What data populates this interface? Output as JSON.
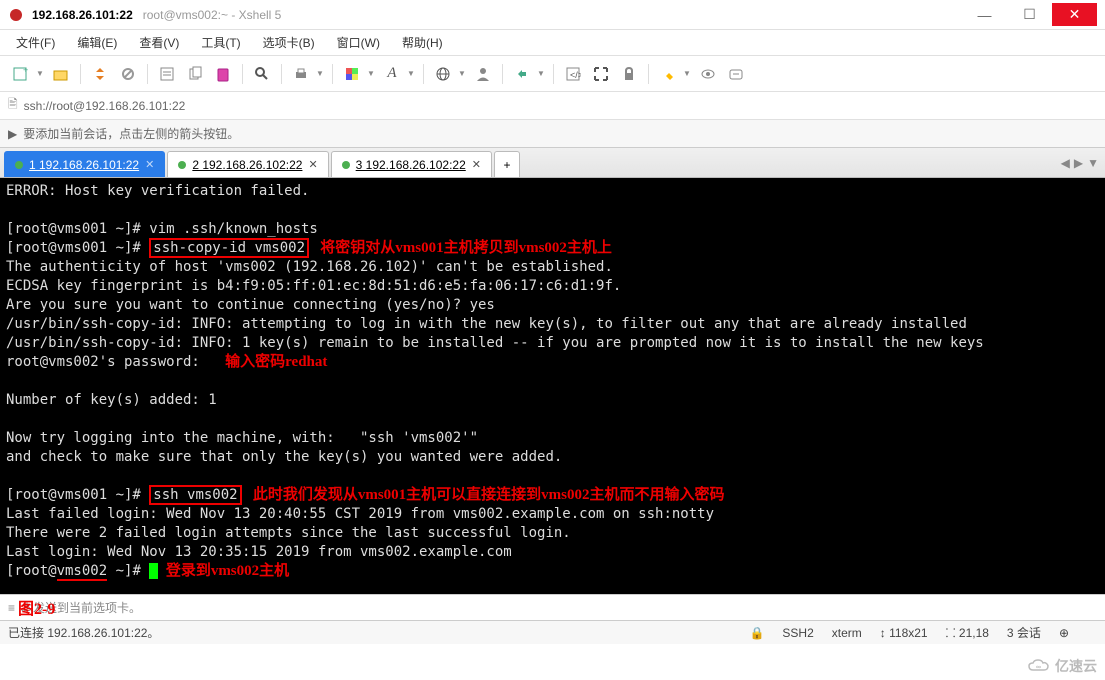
{
  "window": {
    "title_main": "192.168.26.101:22",
    "title_sub": "root@vms002:~ - Xshell 5"
  },
  "menus": [
    "文件(F)",
    "编辑(E)",
    "查看(V)",
    "工具(T)",
    "选项卡(B)",
    "窗口(W)",
    "帮助(H)"
  ],
  "address": "ssh://root@192.168.26.101:22",
  "hint": "要添加当前会话，点击左侧的箭头按钮。",
  "tabs": [
    {
      "label": "1 192.168.26.101:22",
      "active": true
    },
    {
      "label": "2 192.168.26.102:22",
      "active": false
    },
    {
      "label": "3 192.168.26.102:22",
      "active": false
    }
  ],
  "terminal": {
    "l1": "ERROR: Host key verification failed.",
    "l2": "",
    "l3a": "[root@vms001 ~]# vim .ssh/known_hosts",
    "l4a": "[root@vms001 ~]# ",
    "l4_box": "ssh-copy-id vms002",
    "l4_ann": "   将密钥对从vms001主机拷贝到vms002主机上",
    "l5": "The authenticity of host 'vms002 (192.168.26.102)' can't be established.",
    "l6": "ECDSA key fingerprint is b4:f9:05:ff:01:ec:8d:51:d6:e5:fa:06:17:c6:d1:9f.",
    "l7": "Are you sure you want to continue connecting (yes/no)? yes",
    "l8": "/usr/bin/ssh-copy-id: INFO: attempting to log in with the new key(s), to filter out any that are already installed",
    "l9": "/usr/bin/ssh-copy-id: INFO: 1 key(s) remain to be installed -- if you are prompted now it is to install the new keys",
    "l10a": "root@vms002's password:   ",
    "l10_ann": "输入密码redhat",
    "l11": "",
    "l12": "Number of key(s) added: 1",
    "l13": "",
    "l14": "Now try logging into the machine, with:   \"ssh 'vms002'\"",
    "l15": "and check to make sure that only the key(s) you wanted were added.",
    "l16": "",
    "l17a": "[root@vms001 ~]# ",
    "l17_box": "ssh vms002",
    "l17_ann": "   此时我们发现从vms001主机可以直接连接到vms002主机而不用输入密码",
    "l18": "Last failed login: Wed Nov 13 20:40:55 CST 2019 from vms002.example.com on ssh:notty",
    "l19": "There were 2 failed login attempts since the last successful login.",
    "l20": "Last login: Wed Nov 13 20:35:15 2019 from vms002.example.com",
    "l21a": "[root@",
    "l21_under": "vms002",
    "l21b": " ~]# ",
    "l21_ann": "  登录到vms002主机",
    "fig": "图2-9"
  },
  "sendbar_hint": "本发送到当前选项卡。",
  "status": {
    "conn": "已连接 192.168.26.101:22。",
    "ssh": "SSH2",
    "term": "xterm",
    "size": "118x21",
    "pos": "21,18",
    "sess": "3 会话"
  },
  "watermark": "亿速云"
}
